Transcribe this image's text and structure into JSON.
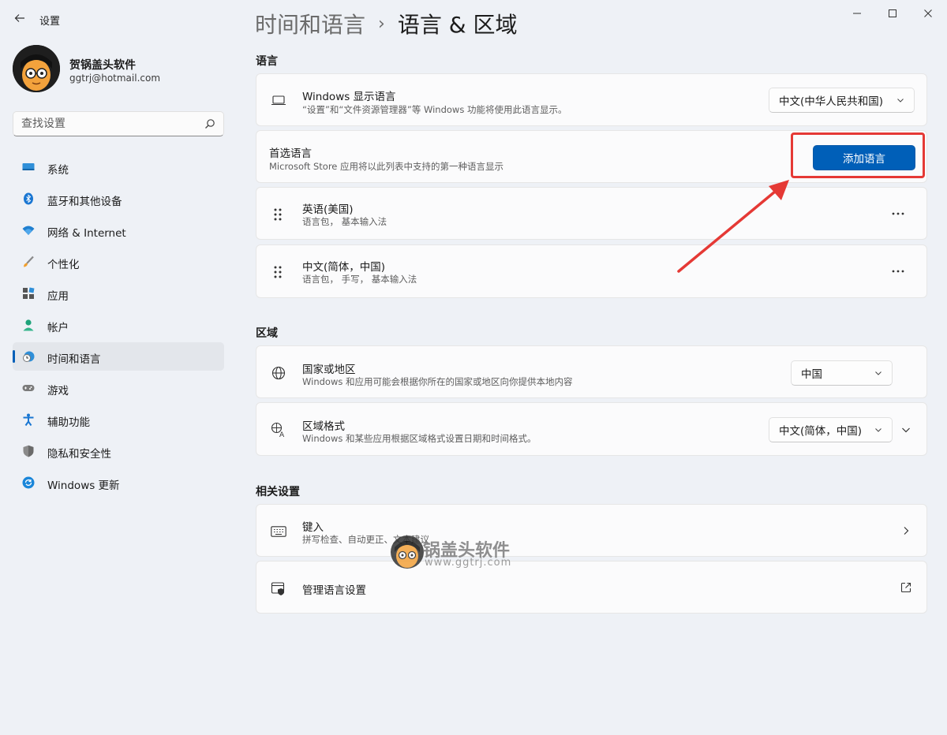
{
  "window": {
    "title": "设置"
  },
  "profile": {
    "name": "贺锅盖头软件",
    "email": "ggtrj@hotmail.com"
  },
  "search": {
    "placeholder": "查找设置"
  },
  "nav": [
    {
      "label": "系统",
      "icon": "system-icon"
    },
    {
      "label": "蓝牙和其他设备",
      "icon": "bluetooth-icon"
    },
    {
      "label": "网络 & Internet",
      "icon": "wifi-icon"
    },
    {
      "label": "个性化",
      "icon": "brush-icon"
    },
    {
      "label": "应用",
      "icon": "apps-icon"
    },
    {
      "label": "帐户",
      "icon": "account-icon"
    },
    {
      "label": "时间和语言",
      "icon": "time-language-icon",
      "active": true
    },
    {
      "label": "游戏",
      "icon": "gamepad-icon"
    },
    {
      "label": "辅助功能",
      "icon": "accessibility-icon"
    },
    {
      "label": "隐私和安全性",
      "icon": "shield-icon"
    },
    {
      "label": "Windows 更新",
      "icon": "update-icon"
    }
  ],
  "breadcrumb": {
    "parent": "时间和语言",
    "separator": "›",
    "current": "语言 & 区域"
  },
  "language": {
    "section_title": "语言",
    "display": {
      "title": "Windows 显示语言",
      "desc": "“设置”和“文件资源管理器”等 Windows 功能将使用此语言显示。",
      "value": "中文(中华人民共和国)"
    },
    "preferred": {
      "title": "首选语言",
      "desc": "Microsoft Store 应用将以此列表中支持的第一种语言显示",
      "button": "添加语言"
    },
    "items": [
      {
        "title": "英语(美国)",
        "desc": "语言包， 基本输入法"
      },
      {
        "title": "中文(简体，中国)",
        "desc": "语言包， 手写， 基本输入法"
      }
    ]
  },
  "region": {
    "section_title": "区域",
    "country": {
      "title": "国家或地区",
      "desc": "Windows 和应用可能会根据你所在的国家或地区向你提供本地内容",
      "value": "中国"
    },
    "format": {
      "title": "区域格式",
      "desc": "Windows 和某些应用根据区域格式设置日期和时间格式。",
      "value": "中文(简体，中国)"
    }
  },
  "related": {
    "section_title": "相关设置",
    "keyboard": {
      "title": "键入",
      "desc": "拼写检查、自动更正、文本建议"
    },
    "admin": {
      "title": "管理语言设置"
    }
  },
  "watermark": {
    "text": "锅盖头软件",
    "url": "www.ggtrj.com"
  },
  "colors": {
    "accent": "#005fb8",
    "annotation": "#e53935",
    "background": "#eef1f6"
  }
}
